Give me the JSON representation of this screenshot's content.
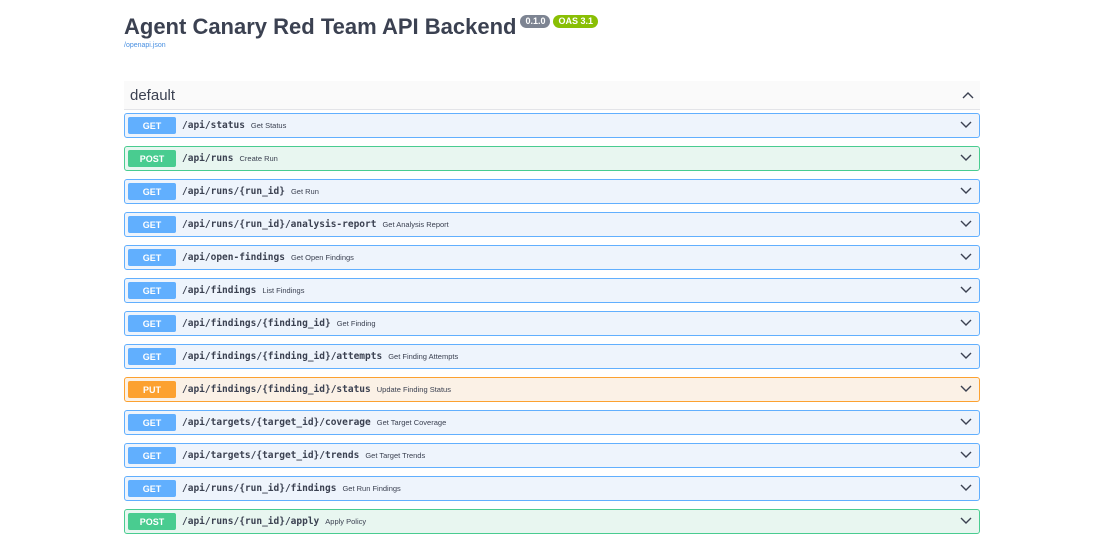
{
  "info": {
    "title": "Agent Canary Red Team API Backend",
    "version": "0.1.0",
    "oas_version": "OAS 3.1",
    "spec_link": "/openapi.json"
  },
  "tag": {
    "name": "default",
    "toggle_icon": "chevron-up-icon"
  },
  "colors": {
    "get": "#61affe",
    "post": "#49cc90",
    "put": "#fca130"
  },
  "operations": [
    {
      "method": "GET",
      "path": "/api/status",
      "summary": "Get Status"
    },
    {
      "method": "POST",
      "path": "/api/runs",
      "summary": "Create Run"
    },
    {
      "method": "GET",
      "path": "/api/runs/{run_id}",
      "summary": "Get Run"
    },
    {
      "method": "GET",
      "path": "/api/runs/{run_id}/analysis-report",
      "summary": "Get Analysis Report"
    },
    {
      "method": "GET",
      "path": "/api/open-findings",
      "summary": "Get Open Findings"
    },
    {
      "method": "GET",
      "path": "/api/findings",
      "summary": "List Findings"
    },
    {
      "method": "GET",
      "path": "/api/findings/{finding_id}",
      "summary": "Get Finding"
    },
    {
      "method": "GET",
      "path": "/api/findings/{finding_id}/attempts",
      "summary": "Get Finding Attempts"
    },
    {
      "method": "PUT",
      "path": "/api/findings/{finding_id}/status",
      "summary": "Update Finding Status"
    },
    {
      "method": "GET",
      "path": "/api/targets/{target_id}/coverage",
      "summary": "Get Target Coverage"
    },
    {
      "method": "GET",
      "path": "/api/targets/{target_id}/trends",
      "summary": "Get Target Trends"
    },
    {
      "method": "GET",
      "path": "/api/runs/{run_id}/findings",
      "summary": "Get Run Findings"
    },
    {
      "method": "POST",
      "path": "/api/runs/{run_id}/apply",
      "summary": "Apply Policy"
    }
  ]
}
